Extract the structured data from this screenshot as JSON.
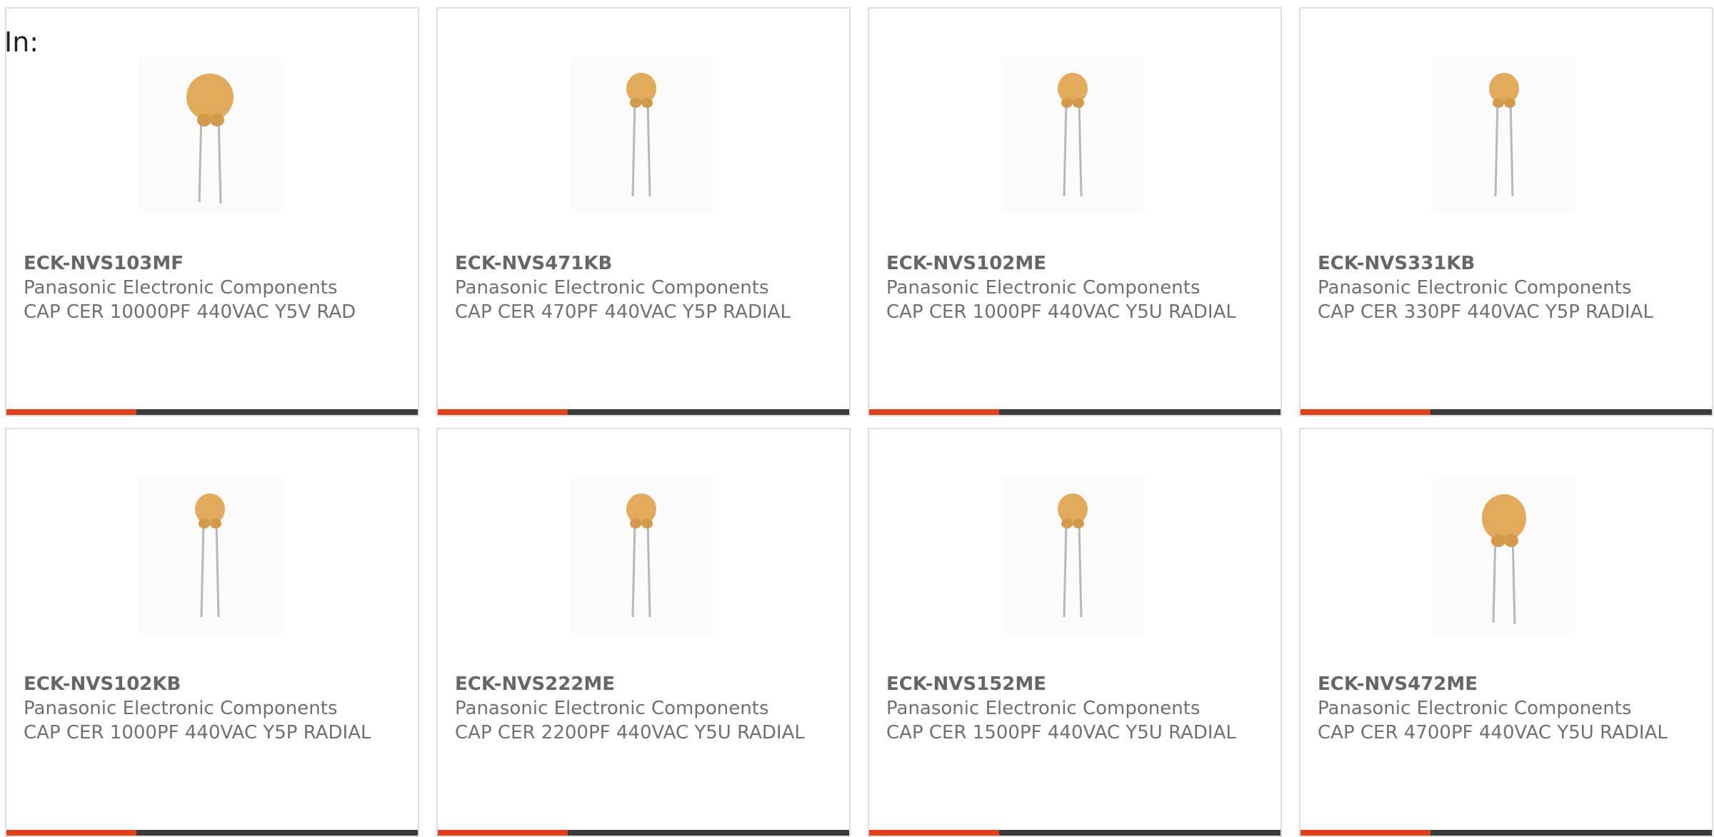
{
  "header": {
    "label": "In:"
  },
  "products": [
    {
      "part_number": "ECK-NVS103MF",
      "manufacturer": "Panasonic Electronic Components",
      "description": "CAP CER 10000PF 440VAC Y5V RAD",
      "image_icon": "radial-ceramic-capacitor-large"
    },
    {
      "part_number": "ECK-NVS471KB",
      "manufacturer": "Panasonic Electronic Components",
      "description": "CAP CER 470PF 440VAC Y5P RADIAL",
      "image_icon": "radial-ceramic-capacitor-small"
    },
    {
      "part_number": "ECK-NVS102ME",
      "manufacturer": "Panasonic Electronic Components",
      "description": "CAP CER 1000PF 440VAC Y5U RADIAL",
      "image_icon": "radial-ceramic-capacitor-small"
    },
    {
      "part_number": "ECK-NVS331KB",
      "manufacturer": "Panasonic Electronic Components",
      "description": "CAP CER 330PF 440VAC Y5P RADIAL",
      "image_icon": "radial-ceramic-capacitor-small"
    },
    {
      "part_number": "ECK-NVS102KB",
      "manufacturer": "Panasonic Electronic Components",
      "description": "CAP CER 1000PF 440VAC Y5P RADIAL",
      "image_icon": "radial-ceramic-capacitor-small"
    },
    {
      "part_number": "ECK-NVS222ME",
      "manufacturer": "Panasonic Electronic Components",
      "description": "CAP CER 2200PF 440VAC Y5U RADIAL",
      "image_icon": "radial-ceramic-capacitor-small"
    },
    {
      "part_number": "ECK-NVS152ME",
      "manufacturer": "Panasonic Electronic Components",
      "description": "CAP CER 1500PF 440VAC Y5U RADIAL",
      "image_icon": "radial-ceramic-capacitor-small"
    },
    {
      "part_number": "ECK-NVS472ME",
      "manufacturer": "Panasonic Electronic Components",
      "description": "CAP CER 4700PF 440VAC Y5U RADIAL",
      "image_icon": "radial-ceramic-capacitor-large"
    }
  ],
  "colors": {
    "accent": "#e0401a",
    "bar": "#3b3b3b",
    "capacitor_body": "#e2aa5c",
    "lead": "#b8b8b8"
  }
}
